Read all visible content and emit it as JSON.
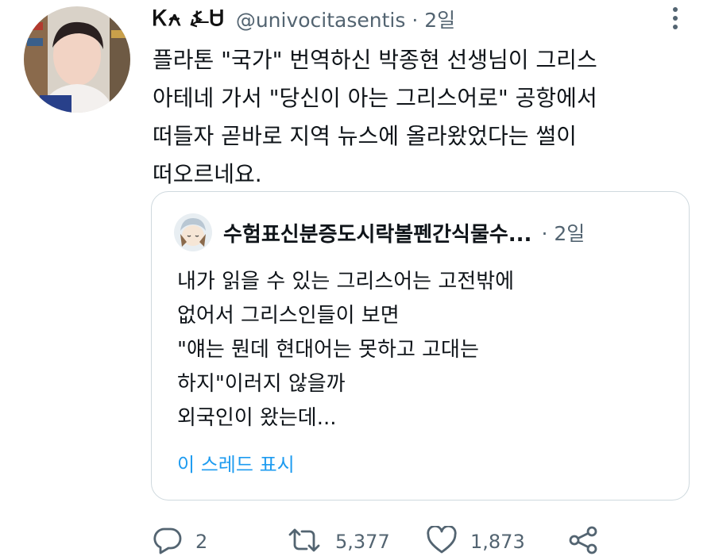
{
  "tweet": {
    "display_name": "Ꮶ⍲ ⍼Ꮜ",
    "handle": "@univocitasentis",
    "time": "2일",
    "text": "플라톤 \"국가\" 번역하신 박종현 선생님이 그리스\n아테네 가서 \"당신이 아는 그리스어로\" 공항에서\n떠들자 곧바로 지역 뉴스에 올라왔었다는 썰이\n떠오르네요."
  },
  "quote": {
    "name": "수험표신분증도시락볼펜간식물수...",
    "time": "2일",
    "text": "내가 읽을 수 있는 그리스어는 고전밖에\n없어서 그리스인들이 보면\n\"얘는 뭔데 현대어는 못하고 고대는\n하지\"이러지 않을까\n외국인이 왔는데...",
    "show_thread": "이 스레드 표시"
  },
  "actions": {
    "reply_count": "2",
    "retweet_count": "5,377",
    "like_count": "1,873"
  },
  "icons": [
    "more-icon",
    "reply-icon",
    "retweet-icon",
    "like-icon",
    "share-icon"
  ],
  "colors": {
    "link": "#1d9bf0",
    "muted": "#536471",
    "border": "#cfd9de"
  }
}
